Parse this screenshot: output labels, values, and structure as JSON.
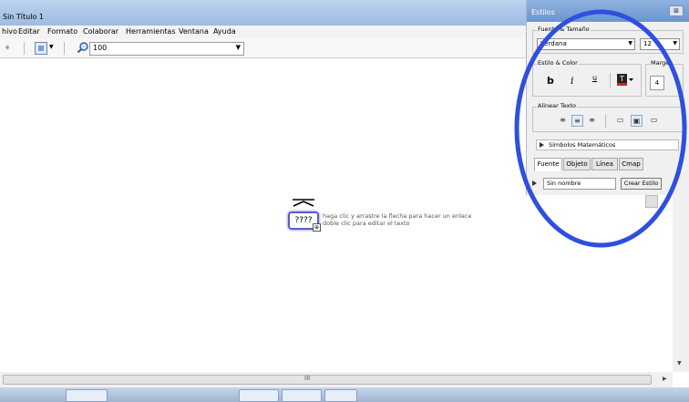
{
  "window": {
    "title": "Sin Título 1"
  },
  "menu": [
    "hivo",
    "Editar",
    "Formato",
    "Colaborar",
    "Herramientas",
    "Ventana",
    "Ayuda"
  ],
  "toolbar": {
    "zoom_value": "100"
  },
  "concept": {
    "label": "????",
    "hint_line1": "haga clic y arrastre la flecha para hacer un enlace",
    "hint_line2": "doble clic para editar el texto"
  },
  "hscroll_grip": "III",
  "panel": {
    "title": "Estilos",
    "close": "⊠",
    "font_group": "Fuente & Tamaño",
    "font_family": "Verdana",
    "font_size": "12",
    "style_group": "Estilo & Color",
    "bold": "b",
    "italic": "i",
    "underline": "u",
    "margin_group": "Margen",
    "margin_value": "4",
    "align_group": "Alinear Texto",
    "math_symbols": "Símbolos Matemáticos",
    "tabs": [
      "Fuente",
      "Objeto",
      "Línea",
      "Cmap"
    ],
    "style_name_placeholder": "Sin nombre",
    "create_style": "Crear Estilo"
  },
  "colors": {
    "annotation_circle": "#2f4fe0",
    "concept_border": "#5660c8",
    "titlebar": "#b0c8e8"
  }
}
